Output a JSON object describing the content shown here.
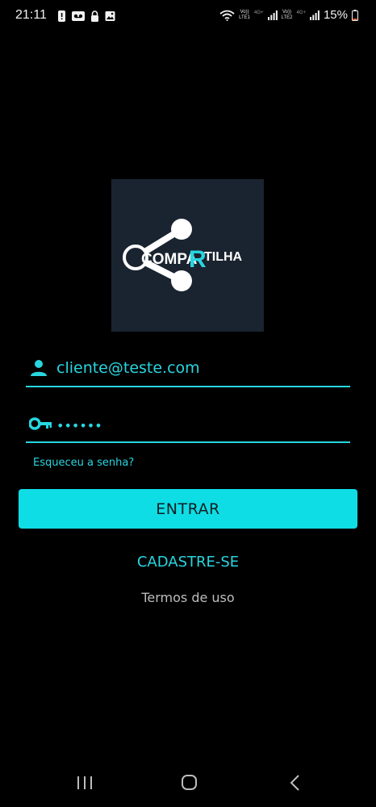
{
  "status_bar": {
    "time": "21:11",
    "left_icons": [
      "alert-icon",
      "voicemail-icon",
      "lock-icon",
      "image-icon"
    ],
    "sim1": {
      "label_top": "Vo))",
      "label_bottom": "LTE1",
      "tech": "4G+"
    },
    "sim2": {
      "label_top": "Vo))",
      "label_bottom": "LTE2",
      "tech": "4G+"
    },
    "battery": "15%"
  },
  "logo": {
    "text_left": "COMPA",
    "text_r": "R",
    "text_right": "TILHA",
    "colors": {
      "background": "#1a2430",
      "accent": "#28d6e0",
      "white": "#ffffff"
    }
  },
  "login": {
    "email_value": "cliente@teste.com",
    "email_icon": "person-icon",
    "password_value": "••••••",
    "password_icon": "key-icon",
    "forgot_password": "Esqueceu a senha?",
    "submit_label": "ENTRAR",
    "register_label": "CADASTRE-SE",
    "terms_label": "Termos de uso"
  },
  "theme": {
    "accent": "#28d6e0",
    "button": "#0fdde5",
    "background": "#000000"
  },
  "nav": {
    "icons": [
      "recent-apps-icon",
      "home-icon",
      "back-icon"
    ]
  }
}
